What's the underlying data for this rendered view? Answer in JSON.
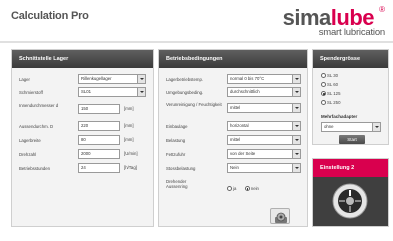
{
  "app": {
    "title": "Calculation Pro",
    "logo_sima": "sima",
    "logo_lube": "lube",
    "logo_reg": "®",
    "logo_tagline": "smart lubrication"
  },
  "colors": {
    "brand": "#d9004e",
    "header_dark": "#4a4a4a"
  },
  "lager": {
    "header": "Schnittstelle Lager",
    "fields": [
      {
        "label": "Lager",
        "value": "Rillenkugellager",
        "type": "select"
      },
      {
        "label": "Schmierstoff",
        "value": "SL01",
        "type": "select"
      },
      {
        "label": "Innendurchmesser d",
        "value": "150",
        "unit": "[mm]",
        "type": "input"
      },
      {
        "label": "Aussendurchm. D",
        "value": "220",
        "unit": "[mm]",
        "type": "input"
      },
      {
        "label": "Lagerbreite",
        "value": "80",
        "unit": "[mm]",
        "type": "input"
      },
      {
        "label": "Drehzahl",
        "value": "2000",
        "unit": "[U/min]",
        "type": "input"
      },
      {
        "label": "Betriebsstunden",
        "value": "24",
        "unit": "[h/Tag]",
        "type": "input"
      }
    ]
  },
  "betrieb": {
    "header": "Betriebsbedingungen",
    "fields": [
      {
        "label": "Lagerbetriebstemp.",
        "value": "normal 0 bis 70°C"
      },
      {
        "label": "Umgebungsbeding.",
        "value": "durchschnittlich"
      },
      {
        "label": "Verunreinigung / Feuchtigkeit",
        "value": "mittel"
      },
      {
        "label": "Einbaulage",
        "value": "horizontal"
      },
      {
        "label": "Belastung",
        "value": "mittel"
      },
      {
        "label": "Fettzufuhr",
        "value": "von der Seite"
      },
      {
        "label": "Stossbelastung",
        "value": "Nein"
      }
    ],
    "rotating": {
      "label": "Drehender Aussenring",
      "option_yes": "ja",
      "option_no": "nein",
      "selected": "nein"
    }
  },
  "spender": {
    "header": "Spendergrösse",
    "options": [
      "SL 30",
      "SL 60",
      "SL 125",
      "SL 250"
    ],
    "selected": "SL 125",
    "adapter_title": "Mehrfachadapter",
    "adapter_value": "ohne",
    "start_label": "Start"
  },
  "einstellung": {
    "header": "Einstellung 2"
  }
}
